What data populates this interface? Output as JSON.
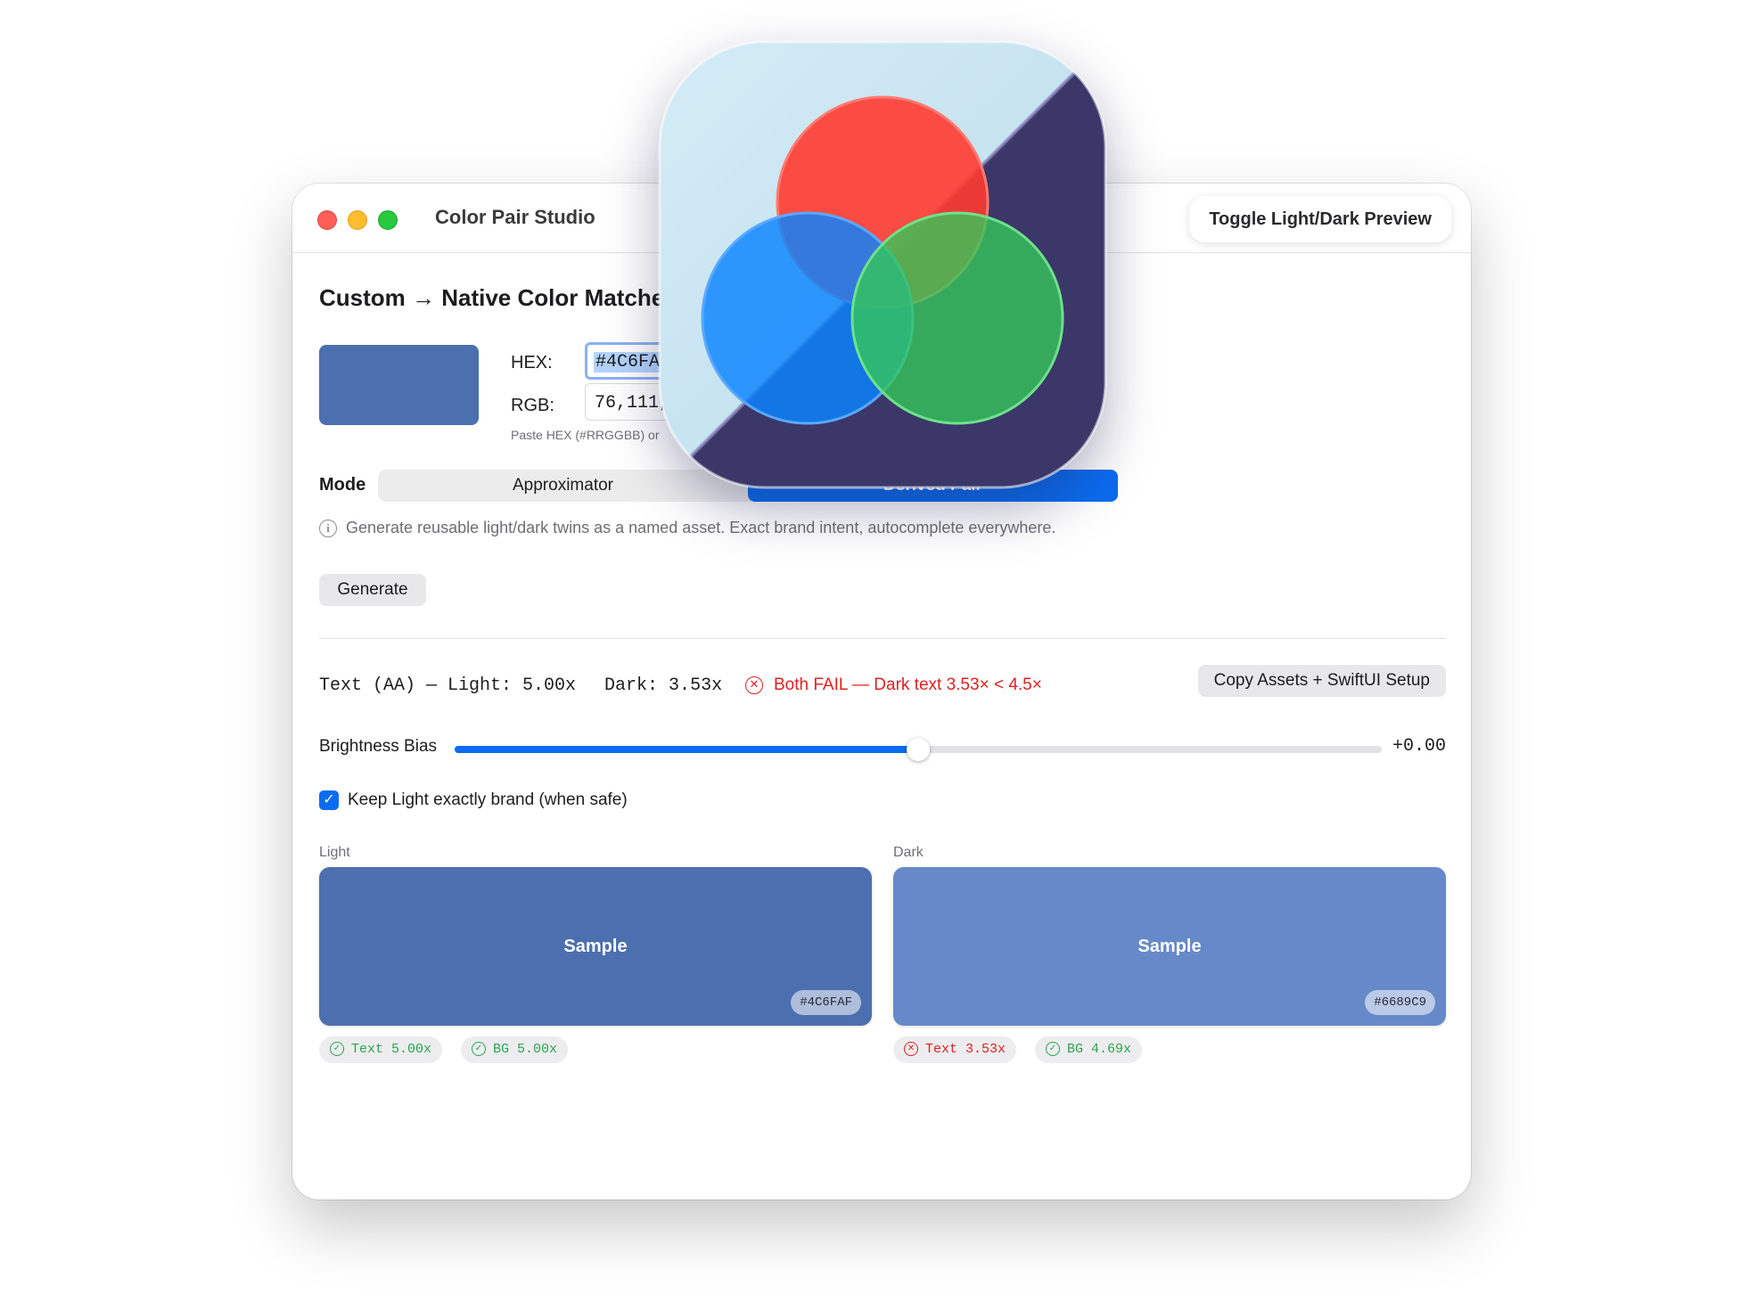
{
  "window": {
    "title": "Color Pair Studio",
    "toggle_button": "Toggle Light/Dark Preview"
  },
  "matcher": {
    "section_title": "Custom → Native Color Matcher",
    "preview_color": "#4C6FAF",
    "hex_label": "HEX:",
    "hex_value": "#4C6FAF",
    "rgb_label": "RGB:",
    "rgb_value": "76,111,175",
    "hint": "Paste HEX (#RRGGBB) or"
  },
  "mode": {
    "label": "Mode",
    "options": [
      "Approximator",
      "Derived Pair"
    ],
    "selected": "Derived Pair",
    "description": "Generate reusable light/dark twins as a named asset. Exact brand intent, autocomplete everywhere."
  },
  "generate_button": "Generate",
  "contrast": {
    "text_light": "Text (AA) — Light: 5.00x",
    "text_dark": "Dark: 3.53x",
    "status": "Both FAIL — Dark text 3.53× < 4.5×",
    "copy_button": "Copy Assets + SwiftUI Setup"
  },
  "brightness": {
    "label": "Brightness Bias",
    "value_text": "+0.00",
    "slider_fraction": 0.5
  },
  "keep_light": {
    "checked": true,
    "label": "Keep Light exactly brand (when safe)"
  },
  "swatches": [
    {
      "caption": "Light",
      "sample_text": "Sample",
      "color": "#4C6FAF",
      "hex": "#4C6FAF",
      "badges": [
        {
          "text": "Text 5.00x",
          "status": "pass"
        },
        {
          "text": "BG 5.00x",
          "status": "pass"
        }
      ]
    },
    {
      "caption": "Dark",
      "sample_text": "Sample",
      "color": "#6689C9",
      "hex": "#6689C9",
      "badges": [
        {
          "text": "Text 3.53x",
          "status": "fail"
        },
        {
          "text": "BG 4.69x",
          "status": "pass"
        }
      ]
    }
  ],
  "colors": {
    "accent": "#0A6CF0",
    "fail": "#E02020",
    "pass": "#2AA44F"
  },
  "app_icon": {
    "name": "rgb-venn-app-icon"
  }
}
